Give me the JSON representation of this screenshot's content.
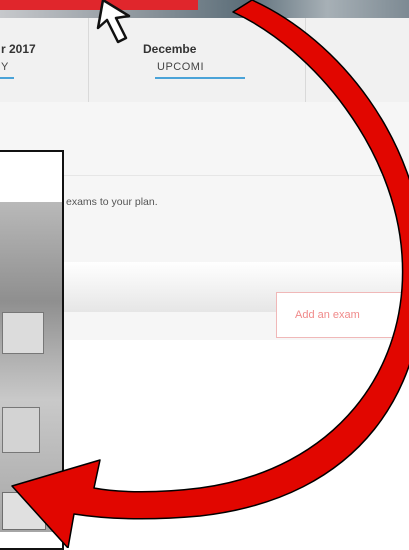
{
  "timeline": {
    "col1": {
      "month": "r 2017",
      "status": "Y"
    },
    "col2": {
      "month": "Decembe",
      "status": "UPCOMI"
    }
  },
  "content": {
    "plan_text": "exams to your plan.",
    "add_exam_label": "Add an exam"
  },
  "colors": {
    "accent_red": "#e0262c",
    "arrow_red": "#e10600",
    "underline_blue": "#4aa3d8"
  },
  "icons": [
    "cursor-pointer-icon",
    "curved-arrow-icon"
  ]
}
